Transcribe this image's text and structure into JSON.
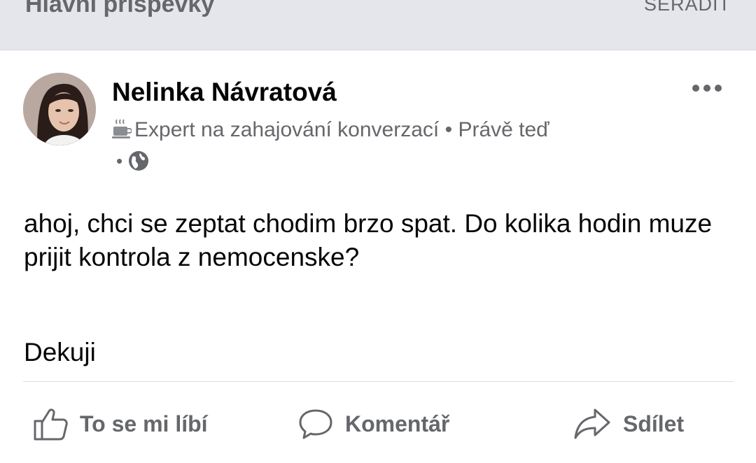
{
  "header": {
    "title": "Hlavní příspěvky",
    "sort_label": "SEŘADIT"
  },
  "post": {
    "author_name": "Nelinka Návratová",
    "badge_icon": "coffee-cup-icon",
    "badge_label": "Expert na zahajování konverzací",
    "separator": "•",
    "time": "Právě teď",
    "privacy_separator": "•",
    "privacy_icon": "globe-icon",
    "text_line1": "ahoj, chci se zeptat chodim brzo spat. Do kolika hodin muze prijit kontrola z nemocenske?",
    "text_line2": "Dekuji"
  },
  "actions": {
    "like_label": "To se mi líbí",
    "comment_label": "Komentář",
    "share_label": "Sdílet"
  },
  "colors": {
    "header_bg": "#e4e6eb",
    "secondary_text": "#65676b",
    "primary_text": "#050505",
    "divider": "#dadde1"
  }
}
